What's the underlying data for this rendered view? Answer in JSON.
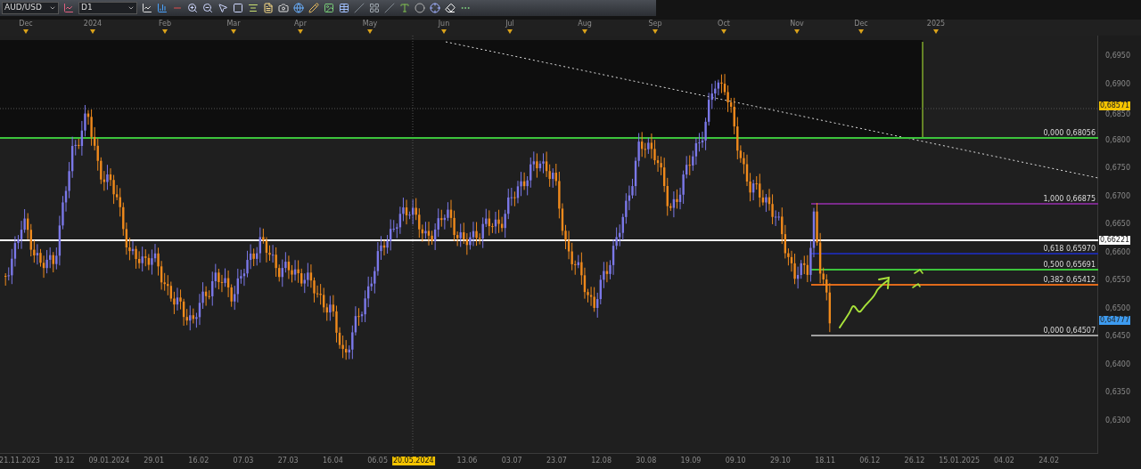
{
  "toolbar": {
    "symbol": "AUD/USD",
    "timeframe": "D1"
  },
  "top_axis": {
    "months": [
      "Dec",
      "2024",
      "Feb",
      "Mar",
      "Apr",
      "May",
      "Jun",
      "Jul",
      "Aug",
      "Sep",
      "Oct",
      "Nov",
      "Dec",
      "2025"
    ]
  },
  "price_axis": {
    "labels": [
      "0,6950",
      "0,6900",
      "0,6850",
      "0,6800",
      "0,6750",
      "0,6700",
      "0,6650",
      "0,6600",
      "0,6550",
      "0,6500",
      "0,6450",
      "0,6400",
      "0,6350",
      "0,6300"
    ]
  },
  "price_tags": [
    {
      "value": "0,68571",
      "color": "#f5c400"
    },
    {
      "value": "0,66221",
      "color": "#ffffff"
    },
    {
      "value": "0,64777",
      "color": "#3d9bf0"
    }
  ],
  "fib_levels": [
    {
      "label": "0,000 0,68056",
      "color": "#3cc43c"
    },
    {
      "label": "1,000 0,66875",
      "color": "#7a2a8a"
    },
    {
      "label": "0,618 0,65970",
      "color": "#1d2aa0"
    },
    {
      "label": "0,500 0,65691",
      "color": "#3cc43c"
    },
    {
      "label": "0,382 0,65412",
      "color": "#e06a1a"
    },
    {
      "label": "0,000 0,64507",
      "color": "#a0a0a0"
    }
  ],
  "bottom_axis": {
    "dates": [
      {
        "label": "21.11.2023",
        "highlighted": false
      },
      {
        "label": "19.12",
        "highlighted": false
      },
      {
        "label": "09.01.2024",
        "highlighted": false
      },
      {
        "label": "29.01",
        "highlighted": false
      },
      {
        "label": "16.02",
        "highlighted": false
      },
      {
        "label": "07.03",
        "highlighted": false
      },
      {
        "label": "27.03",
        "highlighted": false
      },
      {
        "label": "16.04",
        "highlighted": false
      },
      {
        "label": "06.05",
        "highlighted": false
      },
      {
        "label": "20.05.2024",
        "highlighted": true
      },
      {
        "label": "13.06",
        "highlighted": false
      },
      {
        "label": "03.07",
        "highlighted": false
      },
      {
        "label": "23.07",
        "highlighted": false
      },
      {
        "label": "12.08",
        "highlighted": false
      },
      {
        "label": "30.08",
        "highlighted": false
      },
      {
        "label": "19.09",
        "highlighted": false
      },
      {
        "label": "09.10",
        "highlighted": false
      },
      {
        "label": "29.10",
        "highlighted": false
      },
      {
        "label": "18.11",
        "highlighted": false
      },
      {
        "label": "06.12",
        "highlighted": false
      },
      {
        "label": "26.12",
        "highlighted": false
      },
      {
        "label": "15.01.2025",
        "highlighted": false
      },
      {
        "label": "04.02",
        "highlighted": false
      },
      {
        "label": "24.02",
        "highlighted": false
      }
    ]
  }
}
